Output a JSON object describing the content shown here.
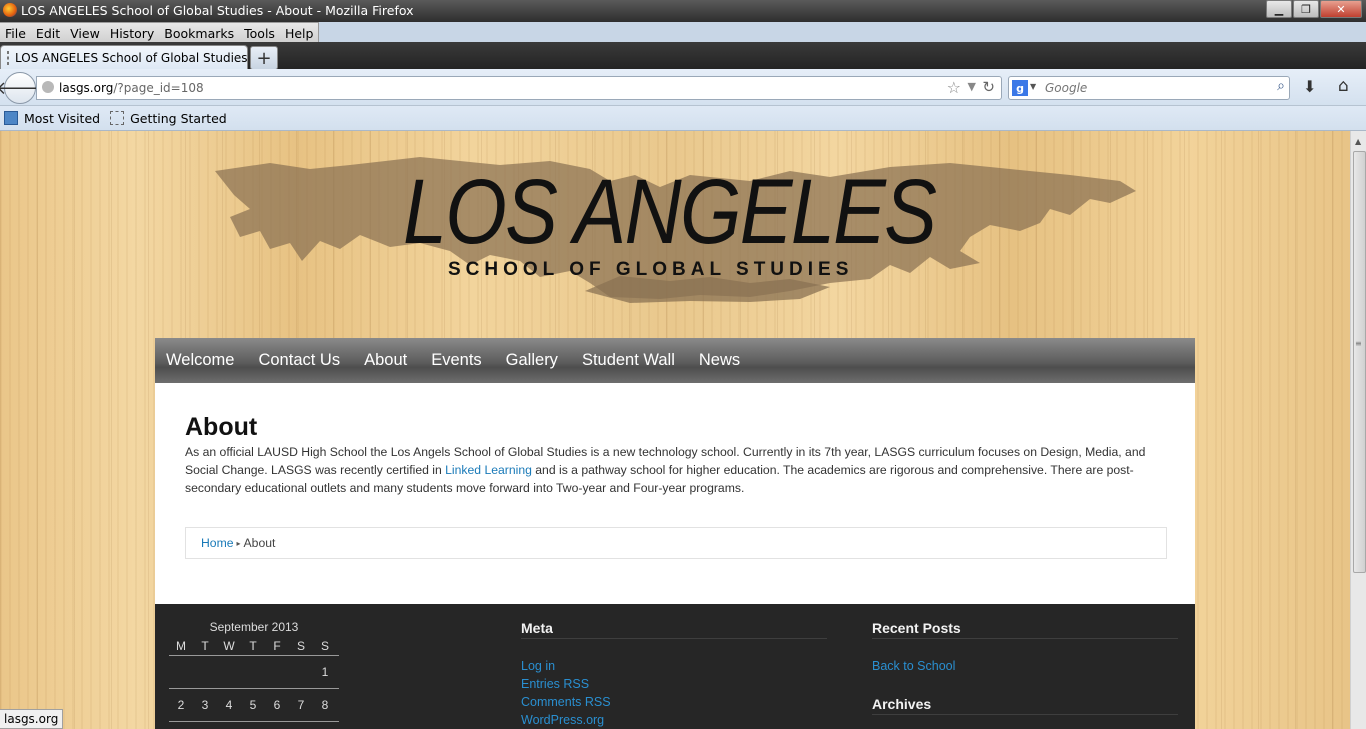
{
  "window": {
    "title": "LOS ANGELES School of Global Studies - About - Mozilla Firefox",
    "controls": {
      "minimize": "▁",
      "restore": "❐",
      "close": "✕"
    }
  },
  "menu": [
    "File",
    "Edit",
    "View",
    "History",
    "Bookmarks",
    "Tools",
    "Help"
  ],
  "tab": {
    "title": "LOS ANGELES School of Global Studies -...",
    "new_tab": "+"
  },
  "navbar": {
    "url_host": "lasgs.org",
    "url_path": "/?page_id=108",
    "search_placeholder": "Google",
    "back_icon": "back-arrow-icon",
    "reload_icon": "reload-icon"
  },
  "bookmarks": [
    "Most Visited",
    "Getting Started"
  ],
  "site": {
    "logo_title": "LOS ANGELES",
    "logo_subtitle": "SCHOOL OF GLOBAL STUDIES",
    "nav": [
      "Welcome",
      "Contact Us",
      "About",
      "Events",
      "Gallery",
      "Student Wall",
      "News"
    ],
    "page_title": "About",
    "para_1": "As an official LAUSD High School the Los Angels School of Global Studies is a new technology school.   Currently in its 7th year, LASGS curriculum focuses on Design, Media, and Social Change.   LASGS was recently certified in ",
    "para_link": "Linked Learning",
    "para_2": " and is a pathway school for higher education.  The academics are rigorous and comprehensive.   There are post-secondary educational outlets and many students move forward into Two-year and Four-year programs.",
    "breadcrumb": {
      "home": "Home",
      "separator": "▸",
      "current": "About"
    }
  },
  "footer": {
    "calendar": {
      "caption": "September 2013",
      "days": [
        "M",
        "T",
        "W",
        "T",
        "F",
        "S",
        "S"
      ],
      "weeks": [
        [
          "",
          "",
          "",
          "",
          "",
          "",
          "1"
        ],
        [
          "2",
          "3",
          "4",
          "5",
          "6",
          "7",
          "8"
        ]
      ]
    },
    "meta": {
      "title": "Meta",
      "links": [
        "Log in",
        "Entries RSS",
        "Comments RSS",
        "WordPress.org"
      ]
    },
    "recent": {
      "title": "Recent Posts",
      "links": [
        "Back to School"
      ]
    },
    "archives": {
      "title": "Archives"
    }
  },
  "status_bar": "lasgs.org",
  "colors": {
    "link": "#1a7ab8",
    "footer_bg": "#262626",
    "nav_bg": "#5c5c5c"
  }
}
